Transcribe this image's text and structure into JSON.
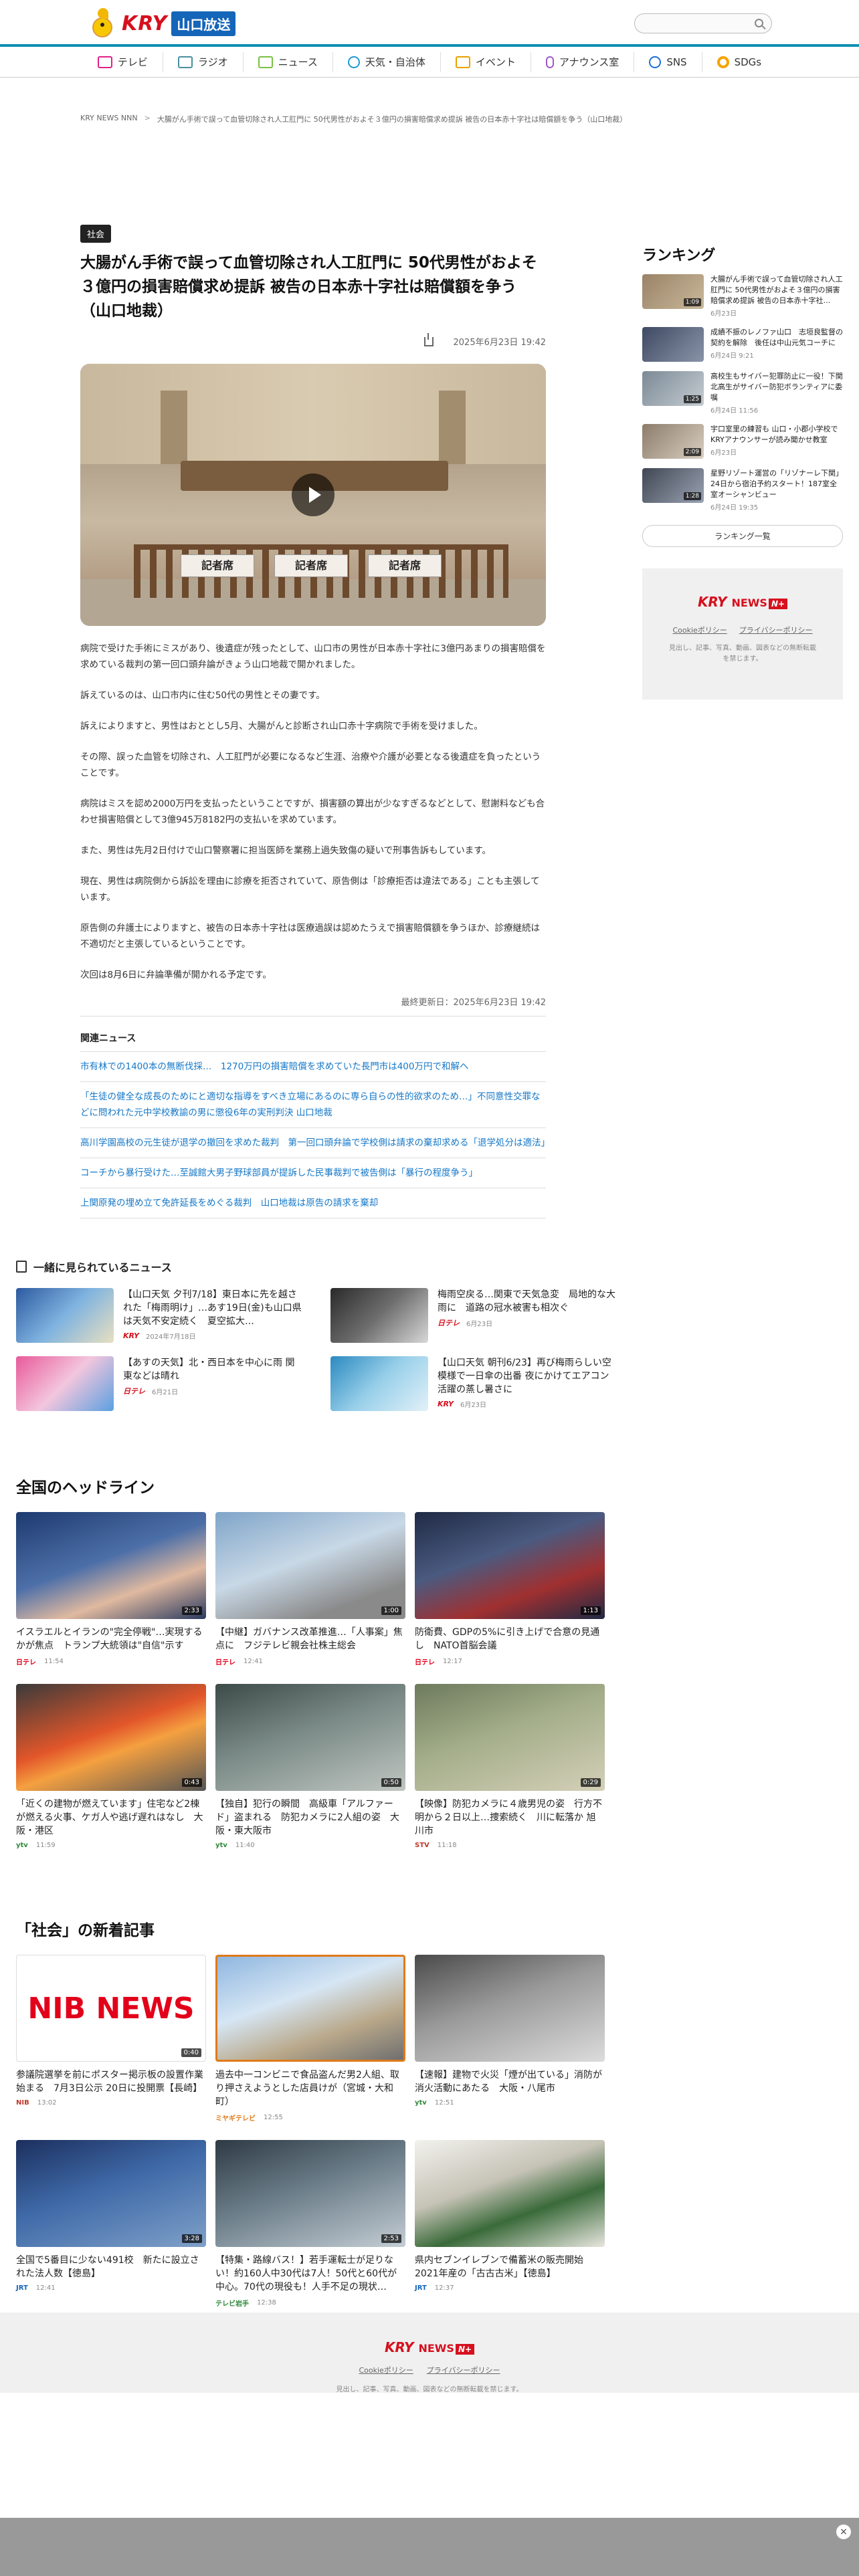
{
  "header": {
    "logo_kry": "KRY",
    "logo_station": "山口放送",
    "search_placeholder": ""
  },
  "nav": [
    {
      "label": "テレビ",
      "icon": "tv-icon"
    },
    {
      "label": "ラジオ",
      "icon": "radio-icon"
    },
    {
      "label": "ニュース",
      "icon": "news-icon"
    },
    {
      "label": "天気・自治体",
      "icon": "weather-icon"
    },
    {
      "label": "イベント",
      "icon": "event-icon"
    },
    {
      "label": "アナウンス室",
      "icon": "microphone-icon"
    },
    {
      "label": "SNS",
      "icon": "sns-icon"
    },
    {
      "label": "SDGs",
      "icon": "sdgs-icon"
    }
  ],
  "breadcrumb": {
    "home": "KRY NEWS NNN",
    "current": "大腸がん手術で誤って血管切除され人工肛門に 50代男性がおよそ３億円の損害賠償求め提訴 被告の日本赤十字社は賠償額を争う（山口地裁）"
  },
  "article": {
    "category": "社会",
    "title": "大腸がん手術で誤って血管切除され人工肛門に 50代男性がおよそ３億円の損害賠償求め提訴 被告の日本赤十字社は賠償額を争う（山口地裁）",
    "date": "2025年6月23日 19:42",
    "video_signs": [
      "記者席",
      "記者席",
      "記者席"
    ],
    "paragraphs": [
      "病院で受けた手術にミスがあり、後遺症が残ったとして、山口市の男性が日本赤十字社に3億円あまりの損害賠償を求めている裁判の第一回口頭弁論がきょう山口地裁で開かれました。",
      "訴えているのは、山口市内に住む50代の男性とその妻です。",
      "訴えによりますと、男性はおととし5月、大腸がんと診断され山口赤十字病院で手術を受けました。",
      "その際、誤った血管を切除され、人工肛門が必要になるなど生涯、治療や介護が必要となる後遺症を負ったということです。",
      "病院はミスを認め2000万円を支払ったということですが、損害額の算出が少なすぎるなどとして、慰謝料なども合わせ損害賠償として3億945万8182円の支払いを求めています。",
      "また、男性は先月2日付けで山口警察署に担当医師を業務上過失致傷の疑いで刑事告訴もしています。",
      "現在、男性は病院側から訴訟を理由に診療を拒否されていて、原告側は「診療拒否は違法である」ことも主張しています。",
      "原告側の弁護士によりますと、被告の日本赤十字社は医療過誤は認めたうえで損害賠償額を争うほか、診療継続は不適切だと主張しているということです。",
      "次回は8月6日に弁論準備が開かれる予定です。"
    ],
    "updated": "最終更新日：2025年6月23日 19:42",
    "related_title": "関連ニュース",
    "related": [
      "市有林での1400本の無断伐採…　1270万円の損害賠償を求めていた長門市は400万円で和解へ",
      "「生徒の健全な成長のためにと適切な指導をすべき立場にあるのに専ら自らの性的欲求のため…」不同意性交罪などに問われた元中学校教諭の男に懲役6年の実刑判決 山口地裁",
      "高川学園高校の元生徒が退学の撤回を求めた裁判　第一回口頭弁論で学校側は請求の棄却求める「退学処分は適法」",
      "コーチから暴行受けた…至誠館大男子野球部員が提訴した民事裁判で被告側は「暴行の程度争う」",
      "上関原発の埋め立て免許延長をめぐる裁判　山口地裁は原告の請求を棄却"
    ]
  },
  "ranking": {
    "title": "ランキング",
    "items": [
      {
        "title": "大腸がん手術で誤って血管切除され人工肛門に 50代男性がおよそ３億円の損害賠償求め提訴 被告の日本赤十字社…",
        "date": "6月23日",
        "duration": "1:09"
      },
      {
        "title": "成績不振のレノファ山口　志垣良監督の契約を解除　後任は中山元気コーチに",
        "date": "6月24日 9:21",
        "duration": ""
      },
      {
        "title": "高校生もサイバー犯罪防止に一役！下関北高生がサイバー防犯ボランティアに委嘱",
        "date": "6月24日 11:56",
        "duration": "1:25"
      },
      {
        "title": "宇口室里の練習も 山口・小郡小学校でKRYアナウンサーが読み聞かせ教室",
        "date": "6月23日",
        "duration": "2:09"
      },
      {
        "title": "星野リゾート運営の「リゾナーレ下関」24日から宿泊予約スタート！187室全室オーシャンビュー",
        "date": "6月24日 19:35",
        "duration": "1:28"
      }
    ],
    "more": "ランキング一覧"
  },
  "side_ad": {
    "logo": "KRY",
    "news": "NEWS",
    "nplus": "N+",
    "links": [
      "Cookieポリシー",
      "プライバシーポリシー"
    ],
    "copy": "見出し、記事、写真、動画、図表などの無断転載を禁じます。"
  },
  "also_viewed": {
    "title": "一緒に見られているニュース",
    "items": [
      {
        "title": "【山口天気 夕刊7/18】東日本に先を越された「梅雨明け」…あす19日(金)も山口県は天気不安定続く　夏空拡大…",
        "source": "KRY",
        "date": "2024年7月18日",
        "duration": ""
      },
      {
        "title": "梅雨空戻る…関東で天気急変　局地的な大雨に　道路の冠水被害も相次ぐ",
        "source": "日テレ",
        "date": "6月23日",
        "duration": "0:36"
      },
      {
        "title": "【あすの天気】北・西日本を中心に雨 関東などは晴れ",
        "source": "日テレ",
        "date": "6月21日",
        "duration": ""
      },
      {
        "title": "【山口天気 朝刊6/23】再び梅雨らしい空模様で一日傘の出番 夜にかけてエアコン活躍の蒸し暑さに",
        "source": "KRY",
        "date": "6月23日",
        "duration": ""
      }
    ]
  },
  "headlines": {
    "title": "全国のヘッドライン",
    "items": [
      {
        "title": "イスラエルとイランの\"完全停戦\"…実現するかが焦点　トランプ大統領は\"自信\"示す",
        "source": "日テレ",
        "date": "11:54",
        "duration": "2:33"
      },
      {
        "title": "【中継】ガバナンス改革推進…「人事案」焦点に　フジテレビ親会社株主総会",
        "source": "日テレ",
        "date": "12:41",
        "duration": "1:00"
      },
      {
        "title": "防衛費、GDPの5%に引き上げで合意の見通し　NATO首脳会議",
        "source": "日テレ",
        "date": "12:17",
        "duration": "1:13"
      },
      {
        "title": "「近くの建物が燃えています」住宅など2棟が燃える火事、ケガ人や逃げ遅れはなし　大阪・港区",
        "source": "ytv",
        "date": "11:59",
        "duration": "0:43"
      },
      {
        "title": "【独自】犯行の瞬間　高級車「アルファード」盗まれる　防犯カメラに2人組の姿　大阪・東大阪市",
        "source": "ytv",
        "date": "11:40",
        "duration": "0:50"
      },
      {
        "title": "【映像】防犯カメラに４歳男児の姿　行方不明から２日以上…捜索続く　川に転落か 旭川市",
        "source": "STV",
        "date": "11:18",
        "duration": "0:29"
      }
    ]
  },
  "society": {
    "title": "「社会」の新着記事",
    "items": [
      {
        "title": "参議院選挙を前にポスター掲示板の設置作業始まる　7月3日公示 20日に投開票【長崎】",
        "source": "NIB",
        "date": "13:02",
        "duration": "0:40"
      },
      {
        "title": "過去中一コンビニで食品盗んだ男2人組、取り押さえようとした店員けが（宮城・大和町）",
        "source": "ミヤギテレビ",
        "date": "12:55",
        "duration": ""
      },
      {
        "title": "【速報】建物で火災「煙が出ている」消防が消火活動にあたる　大阪・八尾市",
        "source": "ytv",
        "date": "12:51",
        "duration": ""
      },
      {
        "title": "全国で5番目に少ない491校　新たに設立された法人数【徳島】",
        "source": "JRT",
        "date": "12:41",
        "duration": "3:28"
      },
      {
        "title": "【特集・路線バス！】若手運転士が足りない！約160人中30代は7人！50代と60代が中心。70代の現役も！人手不足の現状…",
        "source": "テレビ岩手",
        "date": "12:38",
        "duration": "2:53"
      },
      {
        "title": "県内セブンイレブンで備蓄米の販売開始 2021年産の「古古古米」【徳島】",
        "source": "JRT",
        "date": "12:37",
        "duration": ""
      }
    ]
  },
  "footer": {
    "logo": "KRY",
    "news": "NEWS",
    "nplus": "N+",
    "links": [
      "Cookieポリシー",
      "プライバシーポリシー"
    ],
    "copy": "見出し、記事、写真、動画、図表などの無断転載を禁じます。"
  },
  "overlay": {
    "close": "×"
  }
}
